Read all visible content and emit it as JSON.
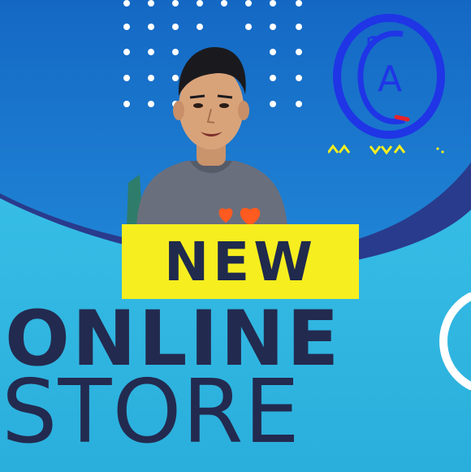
{
  "banner": {
    "new_label": "NEW"
  },
  "headline": {
    "line1": "ONLINE",
    "line2": "STORE"
  },
  "logo": {
    "letter": "A"
  },
  "colors": {
    "sky_top": "#1673c9",
    "sky_bottom": "#2d9ee4",
    "navy_wave": "#293b8c",
    "teal_ground": "#2fb6e0",
    "yellow": "#f6ee1f",
    "text_dark": "#232a4f",
    "logo_blue": "#1f35e6",
    "logo_red": "#e8222a"
  }
}
